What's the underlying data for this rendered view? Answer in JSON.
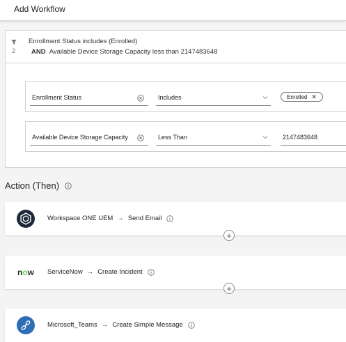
{
  "header": {
    "title": "Add Workflow"
  },
  "filter": {
    "count": "2",
    "summary_line1": "Enrollment Status includes (Enrolled)",
    "summary_and": "AND",
    "summary_line2": "Available Device Storage Capacity less than 2147483648",
    "conditions": [
      {
        "attribute": "Enrollment Status",
        "operator": "Includes",
        "chip_label": "Enrolled",
        "chip_close": "✕"
      },
      {
        "attribute": "Available Device Storage Capacity",
        "operator": "Less Than",
        "value": "2147483648"
      }
    ]
  },
  "actions_section": {
    "title": "Action (Then)"
  },
  "actions": [
    {
      "connector": "Workspace ONE UEM",
      "action": "Send Email",
      "logo_icon": "workspace-one-icon",
      "logo_bg": "#1e2a3a"
    },
    {
      "connector": "ServiceNow",
      "action": "Create Incident",
      "logo_icon": "servicenow-icon",
      "logo_text": "now",
      "logo_accent": "#62d84e"
    },
    {
      "connector": "Microsoft_Teams",
      "action": "Create Simple Message",
      "logo_icon": "microsoft-teams-icon",
      "logo_bg": "#2f6db5"
    }
  ],
  "arrow_glyph": "→",
  "add_glyph": "+"
}
